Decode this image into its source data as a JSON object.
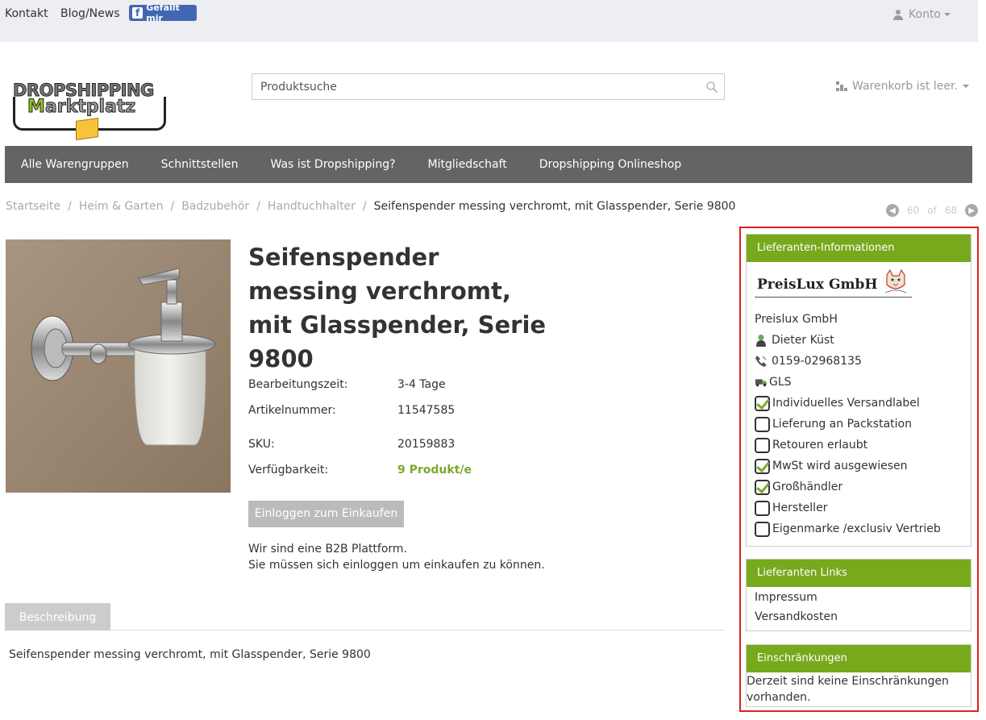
{
  "topbar": {
    "contact": "Kontakt",
    "blog": "Blog/News",
    "facebook_label": "Gefällt mir",
    "account": "Konto"
  },
  "logo": {
    "line1": "DROPSHIPPING",
    "line2_first": "M",
    "line2_rest": "arktplatz"
  },
  "search": {
    "placeholder": "Produktsuche"
  },
  "cart": {
    "label": "Warenkorb ist leer."
  },
  "nav": {
    "items": [
      "Alle Warengruppen",
      "Schnittstellen",
      "Was ist Dropshipping?",
      "Mitgliedschaft",
      "Dropshipping Onlineshop"
    ]
  },
  "breadcrumb": {
    "items": [
      "Startseite",
      "Heim & Garten",
      "Badzubehör",
      "Handtuchhalter"
    ],
    "separator": "/",
    "current": "Seifenspender messing verchromt, mit Glasspender, Serie 9800"
  },
  "pager": {
    "current": "60",
    "of": "of",
    "total": "68"
  },
  "product": {
    "title": "Seifenspender messing verchromt, mit Glasspender, Serie 9800",
    "fields": {
      "processing_label": "Bearbeitungszeit:",
      "processing_value": "3-4 Tage",
      "article_label": "Artikelnummer:",
      "article_value": "11547585",
      "sku_label": "SKU:",
      "sku_value": "20159883",
      "availability_label": "Verfügbarkeit:",
      "availability_value": "9 Produkt/e"
    },
    "login_button": "Einloggen zum Einkaufen",
    "b2b_line1": "Wir sind eine B2B Plattform.",
    "b2b_line2": "Sie müssen sich einloggen um einkaufen zu können."
  },
  "tabs": {
    "description_tab": "Beschreibung",
    "description_text": "Seifenspender messing verchromt, mit Glasspender, Serie 9800"
  },
  "supplier": {
    "heading": "Lieferanten-Informationen",
    "logo_text": "PreisLux GmbH",
    "name": "Preislux GmbH",
    "contact_person": "Dieter Küst",
    "phone": "0159-02968135",
    "carrier": "GLS",
    "features": [
      {
        "label": "Individuelles Versandlabel",
        "checked": true
      },
      {
        "label": "Lieferung an Packstation",
        "checked": false
      },
      {
        "label": "Retouren erlaubt",
        "checked": false
      },
      {
        "label": "MwSt wird ausgewiesen",
        "checked": true
      },
      {
        "label": "Großhändler",
        "checked": true
      },
      {
        "label": "Hersteller",
        "checked": false
      },
      {
        "label": "Eigenmarke /exclusiv Vertrieb",
        "checked": false
      }
    ]
  },
  "supplier_links": {
    "heading": "Lieferanten Links",
    "items": [
      "Impressum",
      "Versandkosten"
    ]
  },
  "restrictions": {
    "heading": "Einschränkungen",
    "text": "Derzeit sind keine Einschränkungen vorhanden."
  },
  "colors": {
    "accent_green": "#77a91c",
    "nav_gray": "#646464",
    "highlight_red": "#e02020"
  }
}
